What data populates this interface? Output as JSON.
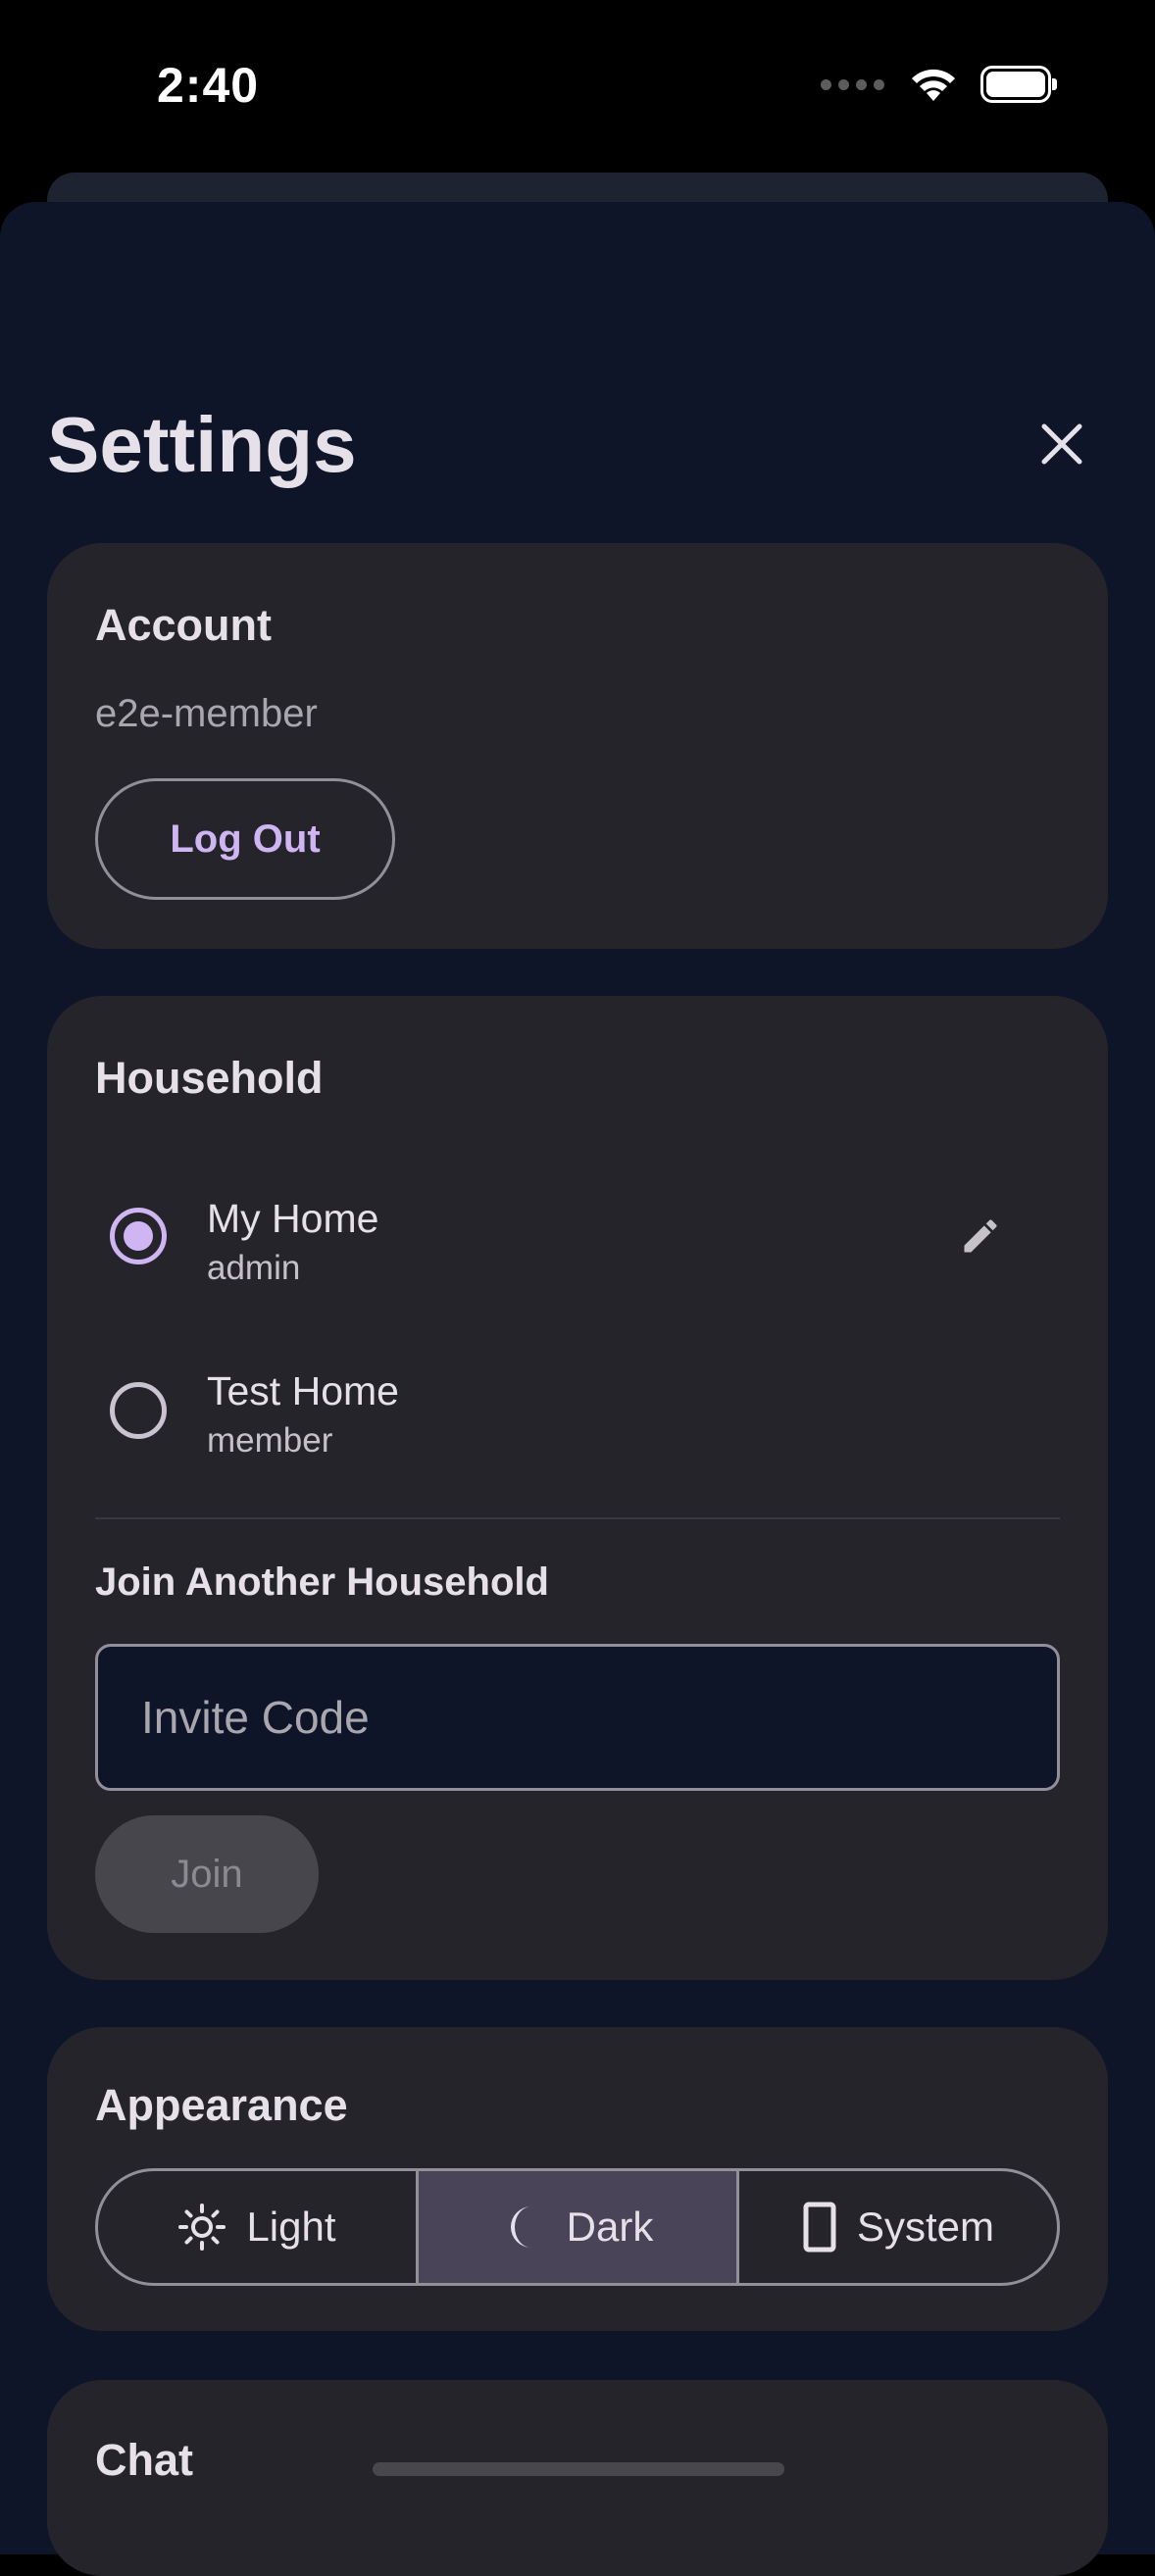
{
  "status_bar": {
    "time": "2:40"
  },
  "header": {
    "title": "Settings",
    "close_icon": "close-icon"
  },
  "account": {
    "title": "Account",
    "username": "e2e-member",
    "logout_label": "Log Out"
  },
  "household": {
    "title": "Household",
    "items": [
      {
        "name": "My Home",
        "role": "admin",
        "selected": true
      },
      {
        "name": "Test Home",
        "role": "member",
        "selected": false
      }
    ],
    "join_title": "Join Another Household",
    "invite_placeholder": "Invite Code",
    "join_label": "Join"
  },
  "appearance": {
    "title": "Appearance",
    "options": [
      {
        "label": "Light",
        "icon": "sun-icon"
      },
      {
        "label": "Dark",
        "icon": "moon-icon"
      },
      {
        "label": "System",
        "icon": "phone-icon"
      }
    ],
    "selected": "Dark"
  },
  "chat": {
    "title": "Chat"
  },
  "colors": {
    "accent": "#cfb6f3",
    "card": "#25242b",
    "sheet": "#0e1528",
    "selected_segment": "#4a4458"
  }
}
